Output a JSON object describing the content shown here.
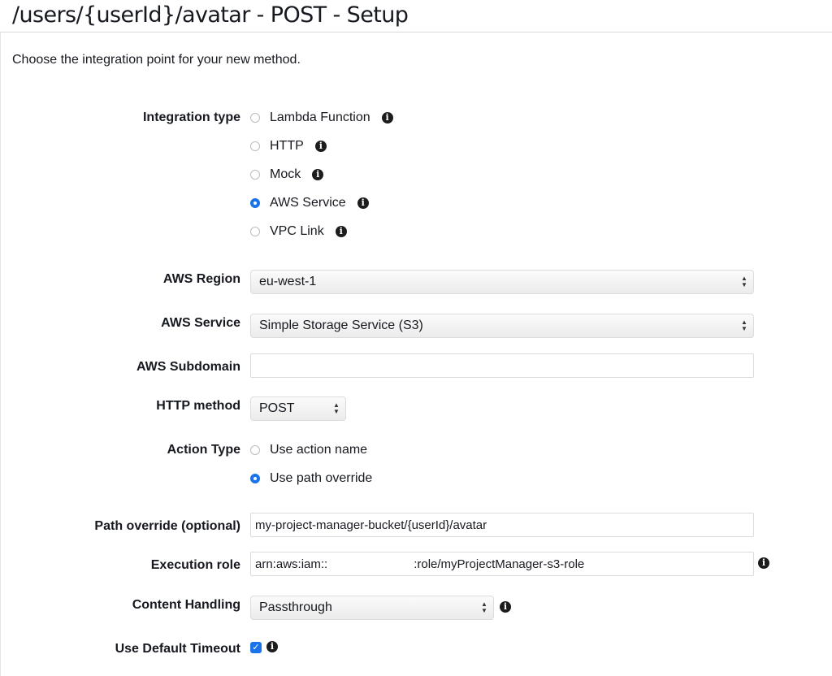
{
  "page": {
    "title": "/users/{userId}/avatar - POST - Setup",
    "subtitle": "Choose the integration point for your new method."
  },
  "integration_type": {
    "label": "Integration type",
    "options": [
      {
        "label": "Lambda Function",
        "checked": false
      },
      {
        "label": "HTTP",
        "checked": false
      },
      {
        "label": "Mock",
        "checked": false
      },
      {
        "label": "AWS Service",
        "checked": true
      },
      {
        "label": "VPC Link",
        "checked": false
      }
    ]
  },
  "aws_region": {
    "label": "AWS Region",
    "value": "eu-west-1"
  },
  "aws_service": {
    "label": "AWS Service",
    "value": "Simple Storage Service (S3)"
  },
  "aws_subdomain": {
    "label": "AWS Subdomain",
    "value": ""
  },
  "http_method": {
    "label": "HTTP method",
    "value": "POST"
  },
  "action_type": {
    "label": "Action Type",
    "options": [
      {
        "label": "Use action name",
        "checked": false
      },
      {
        "label": "Use path override",
        "checked": true
      }
    ]
  },
  "path_override": {
    "label": "Path override (optional)",
    "value": "my-project-manager-bucket/{userId}/avatar"
  },
  "execution_role": {
    "label": "Execution role",
    "value_prefix": "arn:aws:iam::",
    "value_suffix": ":role/myProjectManager-s3-role"
  },
  "content_handling": {
    "label": "Content Handling",
    "value": "Passthrough"
  },
  "default_timeout": {
    "label": "Use Default Timeout",
    "checked": true
  },
  "icons": {
    "info": "info-icon",
    "select": "up-down-chevron-icon",
    "check": "check-icon"
  },
  "colors": {
    "accent": "#1a73e8",
    "text": "#16191f",
    "rule": "#d5dbdb"
  }
}
